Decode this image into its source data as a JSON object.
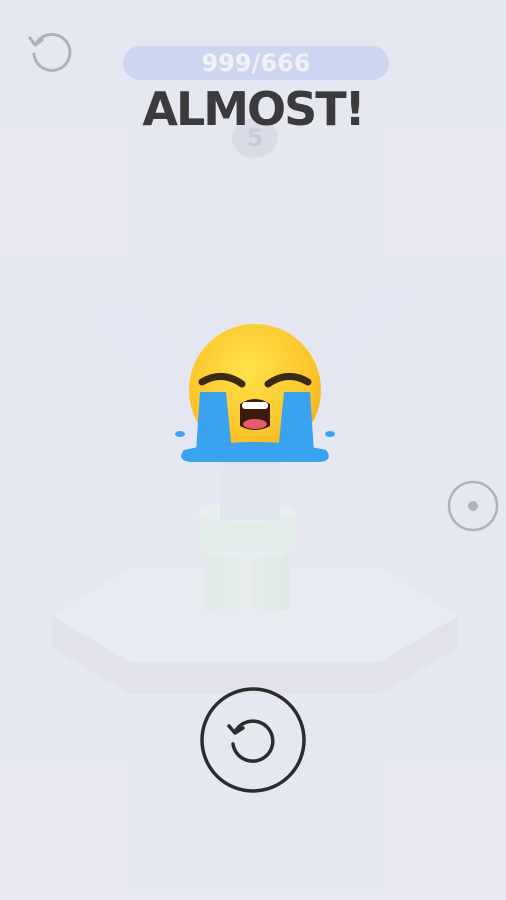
{
  "result": {
    "headline": "ALMOST!"
  },
  "progress": {
    "label": "999/666",
    "fill_fraction": 1.0
  },
  "level": {
    "number": "5"
  },
  "icons": {
    "undo": "undo-icon",
    "emoji": "loudly-crying-face-icon",
    "rotate": "rotate-handle-icon",
    "retry": "retry-icon"
  },
  "colors": {
    "background": "#e5e6f0",
    "headline": "#3b3b3d",
    "emoji_face": "#fcc52a",
    "emoji_tears": "#3aa3f0",
    "retry_outline": "#2c2c2c"
  }
}
